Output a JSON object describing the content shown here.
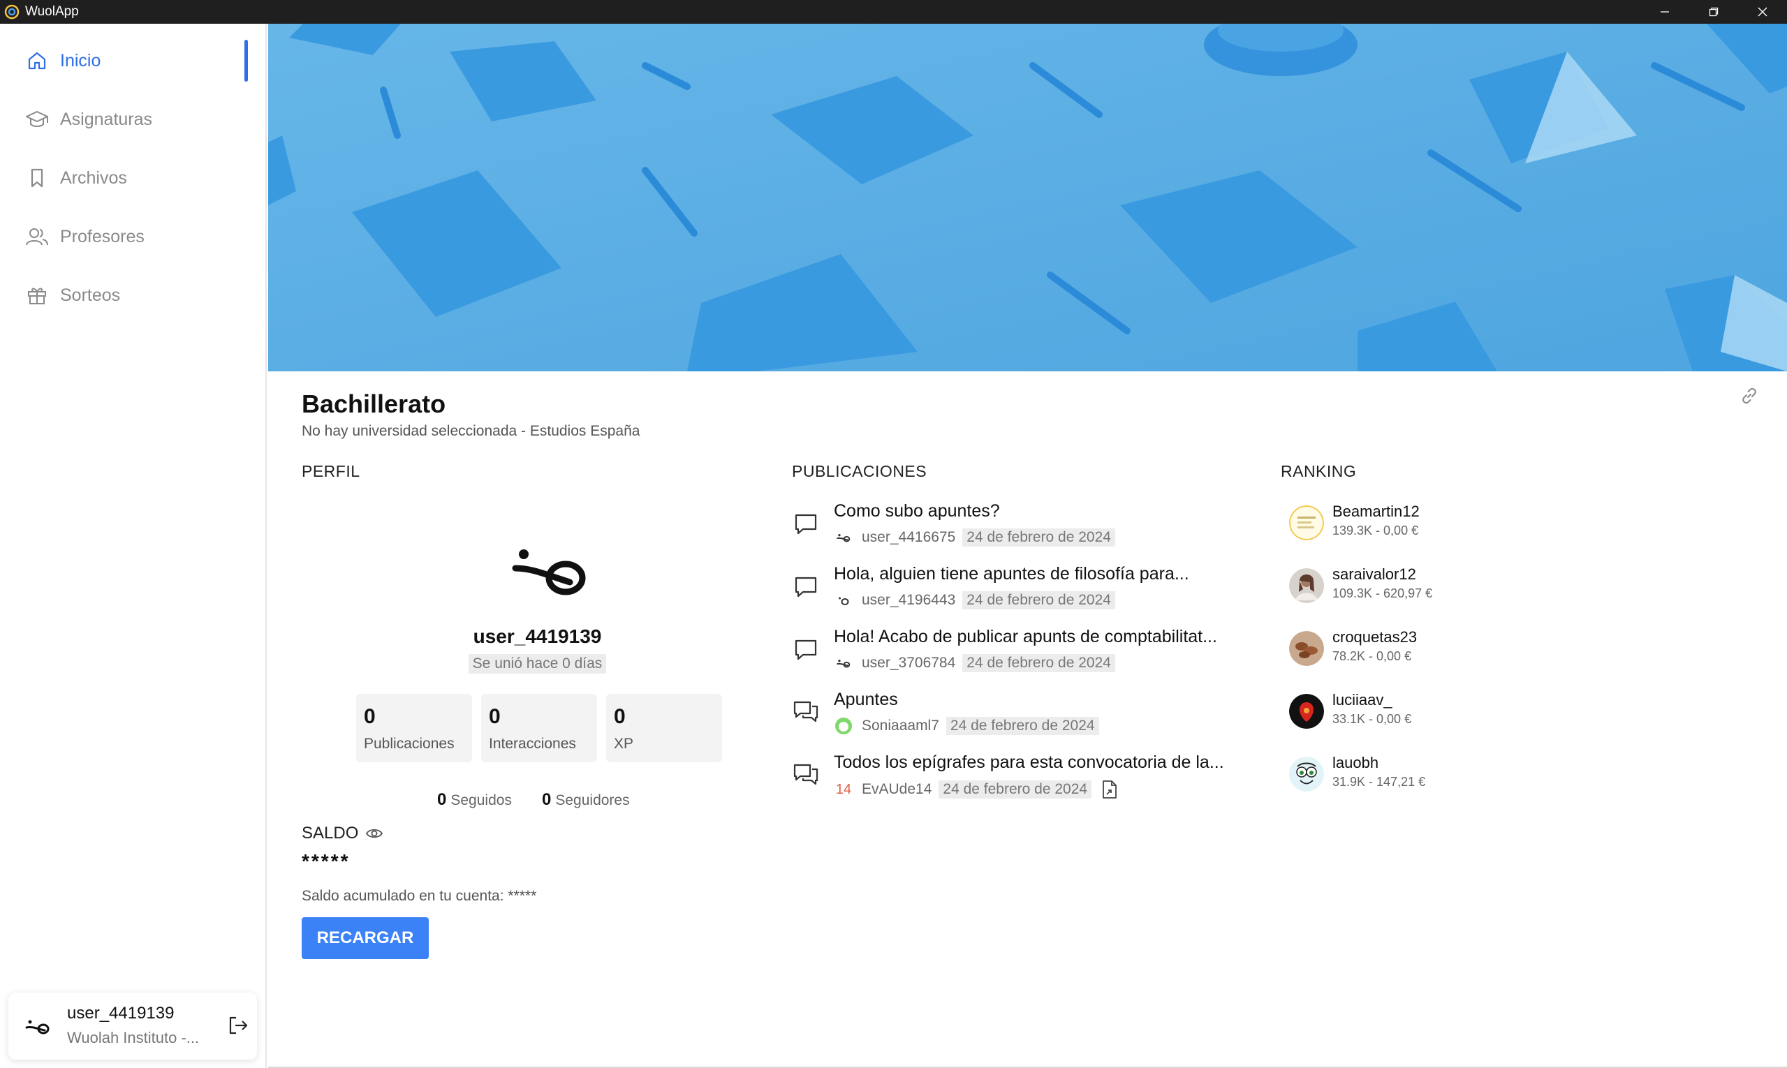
{
  "window": {
    "title": "WuolApp"
  },
  "sidebar": {
    "items": [
      {
        "label": "Inicio",
        "icon": "home-icon",
        "active": true
      },
      {
        "label": "Asignaturas",
        "icon": "graduation-cap-icon",
        "active": false
      },
      {
        "label": "Archivos",
        "icon": "bookmark-icon",
        "active": false
      },
      {
        "label": "Profesores",
        "icon": "users-icon",
        "active": false
      },
      {
        "label": "Sorteos",
        "icon": "gift-icon",
        "active": false
      }
    ],
    "user": {
      "name": "user_4419139",
      "institution": "Wuolah Instituto -..."
    }
  },
  "header": {
    "title": "Bachillerato",
    "subtitle": "No hay universidad seleccionada - Estudios España"
  },
  "profile": {
    "section_title": "PERFIL",
    "username": "user_4419139",
    "joined": "Se unió hace 0 días",
    "stats": [
      {
        "value": "0",
        "label": "Publicaciones"
      },
      {
        "value": "0",
        "label": "Interacciones"
      },
      {
        "value": "0",
        "label": "XP"
      }
    ],
    "following": {
      "value": "0",
      "label": "Seguidos"
    },
    "followers": {
      "value": "0",
      "label": "Seguidores"
    },
    "saldo": {
      "title": "SALDO",
      "value": "*****",
      "note": "Saldo acumulado en tu cuenta: *****",
      "button": "RECARGAR"
    }
  },
  "publications": {
    "section_title": "PUBLICACIONES",
    "items": [
      {
        "title": "Como subo apuntes?",
        "user": "user_4416675",
        "date": "24 de febrero de 2024",
        "icon": "chat-bubble-icon"
      },
      {
        "title": "Hola, alguien tiene apuntes de filosofía para...",
        "user": "user_4196443",
        "date": "24 de febrero de 2024",
        "icon": "chat-bubble-icon"
      },
      {
        "title": "Hola! Acabo de publicar apunts de comptabilitat...",
        "user": "user_3706784",
        "date": "24 de febrero de 2024",
        "icon": "chat-bubble-icon"
      },
      {
        "title": "Apuntes",
        "user": "Soniaaaml7",
        "date": "24 de febrero de 2024",
        "icon": "chat-bubbles-icon"
      },
      {
        "title": "Todos los epígrafes para esta convocatoria de la...",
        "user": "EvAUde14",
        "user_badge": "14",
        "date": "24 de febrero de 2024",
        "icon": "chat-bubbles-icon"
      }
    ]
  },
  "ranking": {
    "section_title": "RANKING",
    "items": [
      {
        "name": "Beamartin12",
        "stats": "139.3K - 0,00 €"
      },
      {
        "name": "saraivalor12",
        "stats": "109.3K - 620,97 €"
      },
      {
        "name": "croquetas23",
        "stats": "78.2K - 0,00 €"
      },
      {
        "name": "luciiaav_",
        "stats": "33.1K - 0,00 €"
      },
      {
        "name": "lauobh",
        "stats": "31.9K - 147,21 €"
      }
    ]
  },
  "colors": {
    "accent": "#2f6fe6",
    "button": "#3b82f6",
    "banner": "#5aaee3"
  }
}
